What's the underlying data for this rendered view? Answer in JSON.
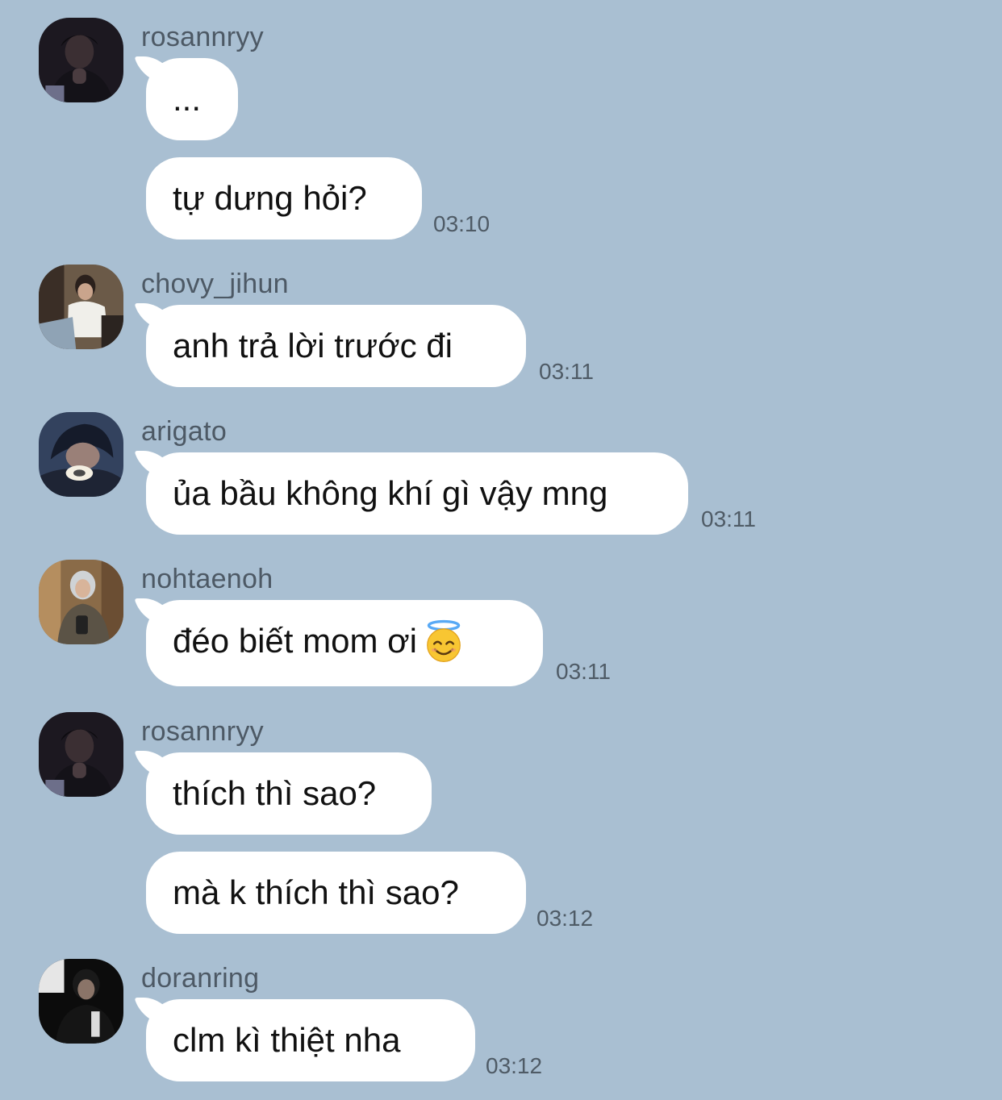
{
  "colors": {
    "background": "#a9bfd2",
    "bubble": "#ffffff",
    "meta_text": "#4f5b66"
  },
  "messages": [
    {
      "sender": "rosannryy",
      "bubbles": [
        "...",
        "tự dưng hỏi?"
      ],
      "time": "03:10"
    },
    {
      "sender": "chovy_jihun",
      "bubbles": [
        "anh trả lời trước đi"
      ],
      "time": "03:11"
    },
    {
      "sender": "arigato",
      "bubbles": [
        "ủa bầu không khí gì vậy mng"
      ],
      "time": "03:11"
    },
    {
      "sender": "nohtaenoh",
      "bubbles": [
        "đéo biết mom ơi"
      ],
      "emoji": "smiling-face-with-halo",
      "time": "03:11"
    },
    {
      "sender": "rosannryy",
      "bubbles": [
        "thích thì sao?",
        "mà k thích thì sao?"
      ],
      "time": "03:12"
    },
    {
      "sender": "doranring",
      "bubbles": [
        "clm kì thiệt nha"
      ],
      "time": "03:12"
    }
  ]
}
